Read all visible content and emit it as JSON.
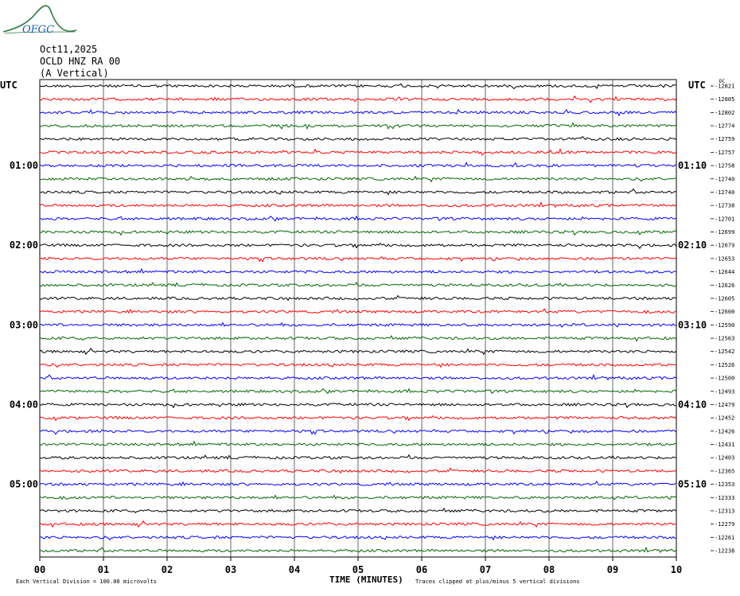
{
  "logo": {
    "text": "OFGC"
  },
  "header": {
    "date": "Oct11,2025",
    "station": "OCLD HNZ RA 00",
    "component": "(A Vertical)"
  },
  "left_tz": "UTC",
  "right_tz": "UTC",
  "dc_label": "DC",
  "colors": {
    "trace_cycle": [
      "#000000",
      "#ff0000",
      "#0000ff",
      "#006600"
    ],
    "grid": "#000000",
    "text": "#000000",
    "logo": "#2c7a3e"
  },
  "chart_data": {
    "type": "line",
    "title": "",
    "xlabel": "TIME (MINUTES)",
    "x_ticks": [
      "00",
      "01",
      "02",
      "03",
      "04",
      "05",
      "06",
      "07",
      "08",
      "09",
      "10"
    ],
    "xlim": [
      0,
      10
    ],
    "left_time_labels": [
      {
        "row": 6,
        "label": "01:00"
      },
      {
        "row": 12,
        "label": "02:00"
      },
      {
        "row": 18,
        "label": "03:00"
      },
      {
        "row": 24,
        "label": "04:00"
      },
      {
        "row": 30,
        "label": "05:00"
      }
    ],
    "right_time_labels": [
      {
        "row": 6,
        "label": "01:10"
      },
      {
        "row": 12,
        "label": "02:10"
      },
      {
        "row": 18,
        "label": "03:10"
      },
      {
        "row": 24,
        "label": "04:10"
      },
      {
        "row": 30,
        "label": "05:10"
      }
    ],
    "dc_offsets": [
      "-12821",
      "-12805",
      "-12802",
      "-12774",
      "-12759",
      "-12757",
      "-12758",
      "-12740",
      "-12740",
      "-12738",
      "-12701",
      "-12699",
      "-12679",
      "-12653",
      "-12644",
      "-12626",
      "-12605",
      "-12600",
      "-12590",
      "-12563",
      "-12542",
      "-12526",
      "-12500",
      "-12493",
      "-12479",
      "-12452",
      "-12426",
      "-12431",
      "-12403",
      "-12365",
      "-12353",
      "-12333",
      "-12313",
      "-12279",
      "-12261",
      "-12238"
    ],
    "grid": true
  },
  "footer": {
    "scale_note": "Each Vertical Division =  100.00 microvolts",
    "clip_note": "Traces clipped at plus/minus 5 vertical divisions"
  }
}
